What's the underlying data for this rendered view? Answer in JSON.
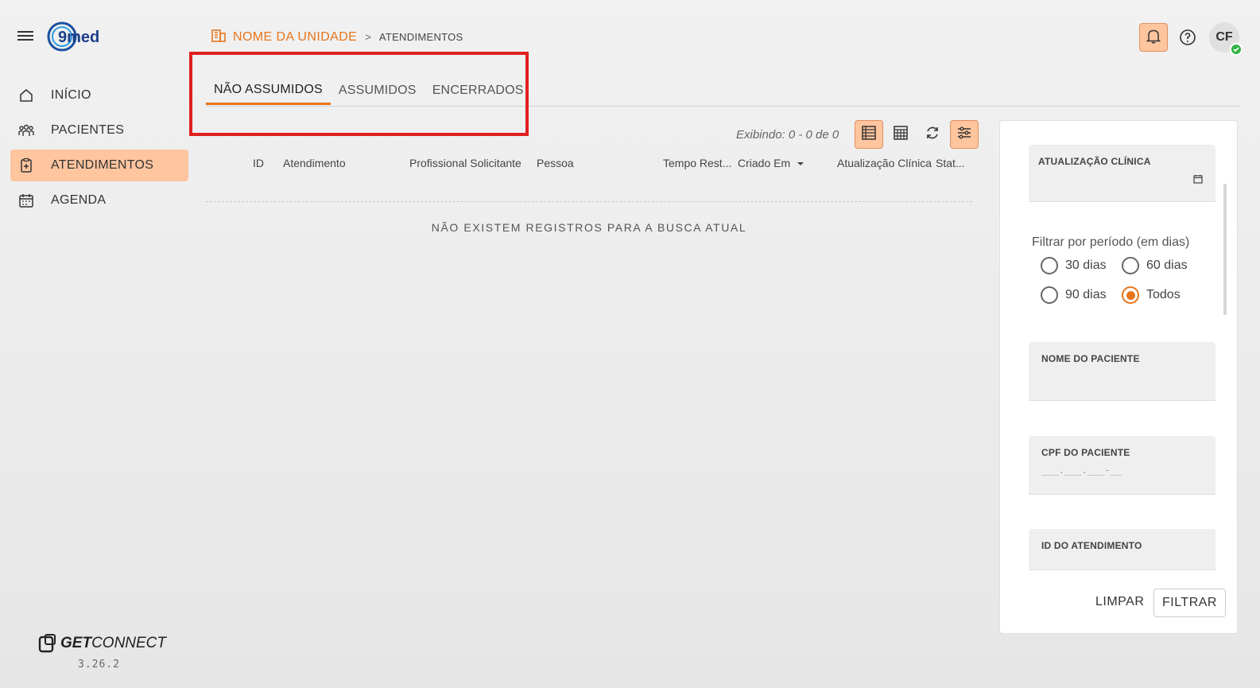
{
  "brand": {
    "logo_text": "9med",
    "footer_brand_bold": "GET",
    "footer_brand_rest": "CONNECT",
    "version": "3.26.2"
  },
  "sidebar": {
    "items": [
      {
        "label": "INÍCIO",
        "icon": "home-icon",
        "active": false
      },
      {
        "label": "PACIENTES",
        "icon": "users-icon",
        "active": false
      },
      {
        "label": "ATENDIMENTOS",
        "icon": "clipboard-plus-icon",
        "active": true
      },
      {
        "label": "AGENDA",
        "icon": "calendar-icon",
        "active": false
      }
    ]
  },
  "breadcrumb": {
    "unit": "NOME DA UNIDADE",
    "separator": ">",
    "page": "ATENDIMENTOS"
  },
  "header": {
    "avatar_initials": "CF",
    "accent": "#e8751a",
    "accent_light": "#ffc59e"
  },
  "tabs": [
    {
      "label": "NÃO ASSUMIDOS",
      "active": true
    },
    {
      "label": "ASSUMIDOS",
      "active": false
    },
    {
      "label": "ENCERRADOS",
      "active": false
    }
  ],
  "toolbar": {
    "showing": "Exibindo: 0 - 0 de 0"
  },
  "table": {
    "columns": [
      "ID",
      "Atendimento",
      "Profissional Solicitante",
      "Pessoa",
      "Tempo Rest...",
      "Criado Em",
      "Atualização Clínica",
      "Stat..."
    ],
    "empty_message": "NÃO EXISTEM REGISTROS PARA A BUSCA ATUAL"
  },
  "filters": {
    "clinical_update_label": "ATUALIZAÇÃO CLÍNICA",
    "period_title": "Filtrar por período (em dias)",
    "period_options": [
      "30 dias",
      "60 dias",
      "90 dias",
      "Todos"
    ],
    "period_selected": "Todos",
    "patient_name_label": "NOME DO PACIENTE",
    "patient_cpf_label": "CPF DO PACIENTE",
    "patient_cpf_placeholder": "___.___.___-__",
    "attendance_id_label": "ID DO ATENDIMENTO",
    "clear_label": "LIMPAR",
    "filter_label": "FILTRAR"
  }
}
